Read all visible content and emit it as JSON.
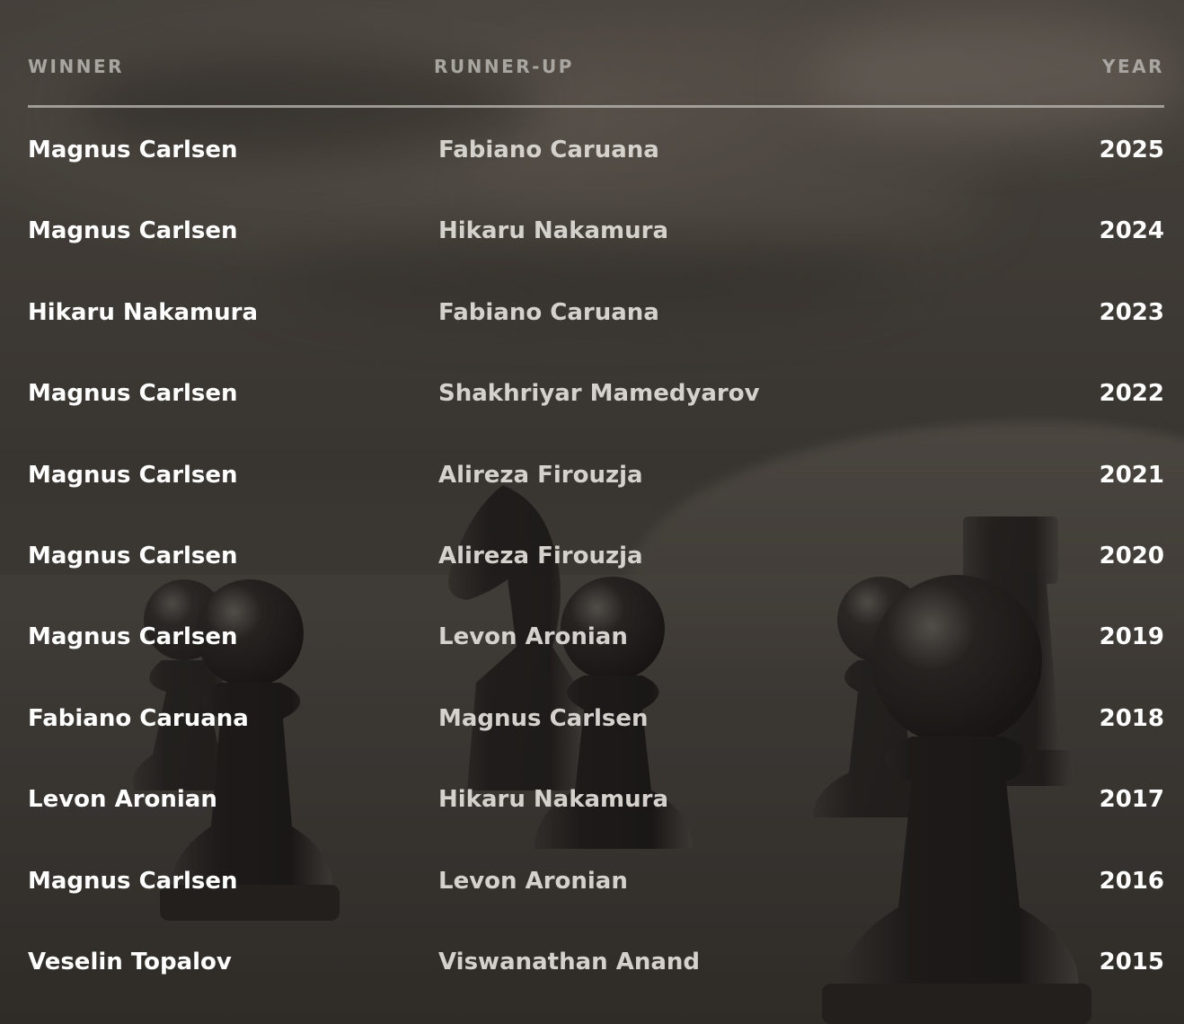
{
  "table": {
    "headers": {
      "winner": "WINNER",
      "runner_up": "RUNNER-UP",
      "year": "YEAR"
    },
    "rows": [
      {
        "winner": "Magnus Carlsen",
        "runner_up": "Fabiano Caruana",
        "year": "2025"
      },
      {
        "winner": "Magnus Carlsen",
        "runner_up": "Hikaru Nakamura",
        "year": "2024"
      },
      {
        "winner": "Hikaru Nakamura",
        "runner_up": "Fabiano Caruana",
        "year": "2023"
      },
      {
        "winner": "Magnus Carlsen",
        "runner_up": "Shakhriyar Mamedyarov",
        "year": "2022"
      },
      {
        "winner": "Magnus Carlsen",
        "runner_up": "Alireza Firouzja",
        "year": "2021"
      },
      {
        "winner": "Magnus Carlsen",
        "runner_up": "Alireza Firouzja",
        "year": "2020"
      },
      {
        "winner": "Magnus Carlsen",
        "runner_up": "Levon Aronian",
        "year": "2019"
      },
      {
        "winner": "Fabiano Caruana",
        "runner_up": "Magnus Carlsen",
        "year": "2018"
      },
      {
        "winner": "Levon Aronian",
        "runner_up": "Hikaru Nakamura",
        "year": "2017"
      },
      {
        "winner": "Magnus Carlsen",
        "runner_up": "Levon Aronian",
        "year": "2016"
      },
      {
        "winner": "Veselin Topalov",
        "runner_up": "Viswanathan Anand",
        "year": "2015"
      }
    ]
  },
  "colors": {
    "header_text": "#a9a5a1",
    "winner_text": "#ffffff",
    "runner_up_text": "#d5d1cd",
    "divider": "#bebab4"
  },
  "background": {
    "icons": [
      "chess-pawn-icon",
      "chess-knight-icon",
      "chess-rook-icon"
    ]
  }
}
